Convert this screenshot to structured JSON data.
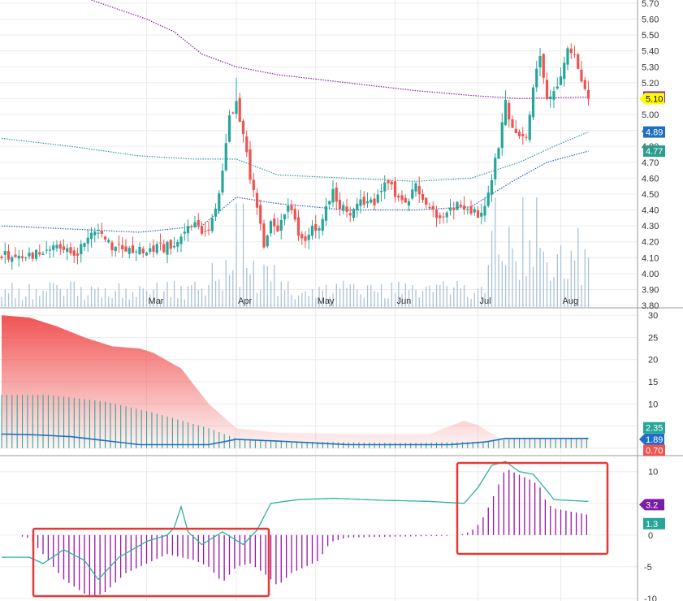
{
  "colors": {
    "up": "#26a69a",
    "down": "#ef5350",
    "volume": "#aac3d6",
    "ma_purple": "#8e1d9e",
    "band_teal": "#2a9d9a",
    "band_blue": "#2f62c7",
    "adx_fill": "#f04a4a",
    "dmi_line": "#1e6fc4",
    "dmi_hist": "#31a89f",
    "macd_hist": "#9a12a8",
    "macd_line": "#2fb0a0",
    "highlight": "#e53935",
    "grid": "#ececec"
  },
  "x_axis": {
    "months": [
      {
        "label": "Mar",
        "day": 42
      },
      {
        "label": "Apr",
        "day": 68
      },
      {
        "label": "May",
        "day": 91
      },
      {
        "label": "Jun",
        "day": 114
      },
      {
        "label": "Jul",
        "day": 138
      },
      {
        "label": "Aug",
        "day": 162
      }
    ]
  },
  "chart_data": [
    {
      "type": "candlestick",
      "name": "price",
      "ylim": [
        3.8,
        5.7
      ],
      "yticks": [
        "5.70",
        "5.60",
        "5.50",
        "5.40",
        "5.30",
        "5.20",
        "5.10",
        "5.00",
        "4.90",
        "4.80",
        "4.70",
        "4.60",
        "4.50",
        "4.40",
        "4.30",
        "4.20",
        "4.10",
        "4.00",
        "3.90",
        "3.80"
      ],
      "anchors": [
        [
          0,
          4.12
        ],
        [
          8,
          4.1
        ],
        [
          14,
          4.18
        ],
        [
          22,
          4.14
        ],
        [
          27,
          4.25
        ],
        [
          32,
          4.18
        ],
        [
          38,
          4.13
        ],
        [
          44,
          4.15
        ],
        [
          50,
          4.18
        ],
        [
          55,
          4.3
        ],
        [
          60,
          4.26
        ],
        [
          62,
          4.42
        ],
        [
          64,
          4.65
        ],
        [
          66,
          5.0
        ],
        [
          68,
          5.06
        ],
        [
          70,
          4.85
        ],
        [
          72,
          4.62
        ],
        [
          74,
          4.42
        ],
        [
          76,
          4.14
        ],
        [
          78,
          4.36
        ],
        [
          80,
          4.3
        ],
        [
          82,
          4.4
        ],
        [
          84,
          4.4
        ],
        [
          86,
          4.25
        ],
        [
          88,
          4.2
        ],
        [
          90,
          4.3
        ],
        [
          92,
          4.28
        ],
        [
          94,
          4.42
        ],
        [
          96,
          4.5
        ],
        [
          98,
          4.4
        ],
        [
          100,
          4.42
        ],
        [
          102,
          4.38
        ],
        [
          104,
          4.45
        ],
        [
          106,
          4.48
        ],
        [
          108,
          4.45
        ],
        [
          110,
          4.5
        ],
        [
          112,
          4.58
        ],
        [
          114,
          4.48
        ],
        [
          116,
          4.45
        ],
        [
          118,
          4.46
        ],
        [
          120,
          4.6
        ],
        [
          122,
          4.46
        ],
        [
          124,
          4.42
        ],
        [
          126,
          4.38
        ],
        [
          128,
          4.36
        ],
        [
          130,
          4.38
        ],
        [
          132,
          4.42
        ],
        [
          134,
          4.4
        ],
        [
          136,
          4.4
        ],
        [
          138,
          4.36
        ],
        [
          140,
          4.45
        ],
        [
          142,
          4.6
        ],
        [
          144,
          4.8
        ],
        [
          146,
          5.08
        ],
        [
          148,
          4.92
        ],
        [
          150,
          4.84
        ],
        [
          152,
          4.88
        ],
        [
          154,
          5.15
        ],
        [
          156,
          5.4
        ],
        [
          158,
          5.08
        ],
        [
          160,
          5.15
        ],
        [
          162,
          5.25
        ],
        [
          164,
          5.4
        ],
        [
          166,
          5.35
        ],
        [
          168,
          5.2
        ],
        [
          170,
          5.1
        ]
      ],
      "y_labels": [
        {
          "text": "5.11",
          "value": 5.11,
          "color": "#8e1d9e"
        },
        {
          "text": "5.10",
          "value": 5.1,
          "color": "#ffff00"
        },
        {
          "text": "4.89",
          "value": 4.89,
          "color": "#1e6fc4"
        },
        {
          "text": "4.77",
          "value": 4.77,
          "color": "#2a9d8f"
        }
      ],
      "overlays": [
        {
          "name": "long-moving-average",
          "anchors": [
            [
              26,
              5.72
            ],
            [
              42,
              5.6
            ],
            [
              50,
              5.52
            ],
            [
              58,
              5.38
            ],
            [
              68,
              5.3
            ],
            [
              80,
              5.25
            ],
            [
              100,
              5.2
            ],
            [
              120,
              5.15
            ],
            [
              136,
              5.12
            ],
            [
              150,
              5.1
            ],
            [
              170,
              5.11
            ]
          ]
        },
        {
          "name": "upper-band",
          "anchors": [
            [
              0,
              4.85
            ],
            [
              20,
              4.8
            ],
            [
              40,
              4.74
            ],
            [
              56,
              4.72
            ],
            [
              68,
              4.72
            ],
            [
              80,
              4.62
            ],
            [
              100,
              4.6
            ],
            [
              120,
              4.58
            ],
            [
              136,
              4.6
            ],
            [
              150,
              4.7
            ],
            [
              160,
              4.8
            ],
            [
              170,
              4.89
            ]
          ]
        },
        {
          "name": "lower-band",
          "anchors": [
            [
              0,
              4.3
            ],
            [
              20,
              4.28
            ],
            [
              40,
              4.26
            ],
            [
              58,
              4.3
            ],
            [
              68,
              4.48
            ],
            [
              80,
              4.44
            ],
            [
              100,
              4.4
            ],
            [
              120,
              4.4
            ],
            [
              136,
              4.42
            ],
            [
              148,
              4.58
            ],
            [
              158,
              4.7
            ],
            [
              170,
              4.77
            ]
          ]
        }
      ]
    },
    {
      "type": "area",
      "name": "adx-panel",
      "ylim": [
        0,
        30
      ],
      "yticks": [
        30,
        25,
        20,
        15,
        10,
        5,
        0
      ],
      "area_anchors": [
        [
          0,
          30
        ],
        [
          8,
          29.5
        ],
        [
          16,
          27.5
        ],
        [
          24,
          25
        ],
        [
          32,
          23
        ],
        [
          40,
          22.5
        ],
        [
          44,
          21.5
        ],
        [
          52,
          18
        ],
        [
          60,
          10
        ],
        [
          68,
          4.5
        ],
        [
          80,
          3.5
        ],
        [
          100,
          3.2
        ],
        [
          124,
          3.2
        ],
        [
          134,
          6.2
        ],
        [
          138,
          5.2
        ],
        [
          144,
          2.3
        ],
        [
          170,
          2.4
        ]
      ],
      "hist_anchors": [
        [
          0,
          12
        ],
        [
          14,
          12
        ],
        [
          30,
          10.5
        ],
        [
          44,
          8
        ],
        [
          60,
          4.5
        ],
        [
          68,
          2.2
        ],
        [
          80,
          1.5
        ],
        [
          120,
          1.2
        ],
        [
          140,
          1.5
        ],
        [
          150,
          2.2
        ],
        [
          170,
          2.2
        ]
      ],
      "line_anchors": [
        [
          0,
          3.2
        ],
        [
          10,
          3.0
        ],
        [
          20,
          2.6
        ],
        [
          40,
          0.8
        ],
        [
          60,
          0.8
        ],
        [
          68,
          2.0
        ],
        [
          80,
          1.6
        ],
        [
          100,
          0.8
        ],
        [
          130,
          0.8
        ],
        [
          140,
          1.4
        ],
        [
          146,
          2.2
        ],
        [
          170,
          2.2
        ]
      ],
      "y_labels": [
        {
          "text": "2.35",
          "value": 4.6,
          "color": "#26a69a"
        },
        {
          "text": "1.89",
          "value": 2.0,
          "color": "#1e6fc4"
        },
        {
          "text": "0.70",
          "value": -0.5,
          "color": "#ef5350"
        }
      ]
    },
    {
      "type": "bar",
      "name": "macd-panel",
      "ylim": [
        -10,
        12
      ],
      "yticks": [
        10,
        5,
        0,
        -5,
        -10
      ],
      "hist_anchors": [
        [
          0,
          0
        ],
        [
          4,
          0
        ],
        [
          8,
          -0.5
        ],
        [
          12,
          -3
        ],
        [
          18,
          -7
        ],
        [
          26,
          -10
        ],
        [
          30,
          -9
        ],
        [
          36,
          -6
        ],
        [
          40,
          -5
        ],
        [
          44,
          -4
        ],
        [
          48,
          -3
        ],
        [
          52,
          -3.5
        ],
        [
          56,
          -4
        ],
        [
          60,
          -5
        ],
        [
          64,
          -7.5
        ],
        [
          68,
          -5
        ],
        [
          72,
          -4.5
        ],
        [
          76,
          -6
        ],
        [
          80,
          -8
        ],
        [
          84,
          -6
        ],
        [
          88,
          -5
        ],
        [
          92,
          -4
        ],
        [
          94,
          -2
        ],
        [
          96,
          -1
        ],
        [
          100,
          -0.4
        ],
        [
          108,
          -0.3
        ],
        [
          120,
          -0.2
        ],
        [
          130,
          -0.1
        ],
        [
          134,
          0.2
        ],
        [
          136,
          0.6
        ],
        [
          138,
          1.6
        ],
        [
          140,
          3.2
        ],
        [
          142,
          5.5
        ],
        [
          144,
          8
        ],
        [
          146,
          10.5
        ],
        [
          148,
          10
        ],
        [
          150,
          9.5
        ],
        [
          152,
          9
        ],
        [
          154,
          8.5
        ],
        [
          156,
          7.5
        ],
        [
          158,
          5
        ],
        [
          160,
          4.2
        ],
        [
          162,
          4
        ],
        [
          170,
          3.2
        ]
      ],
      "line_anchors": [
        [
          0,
          -3.5
        ],
        [
          8,
          -3.5
        ],
        [
          12,
          -4.5
        ],
        [
          18,
          -2.3
        ],
        [
          24,
          -4
        ],
        [
          28,
          -7
        ],
        [
          34,
          -3.5
        ],
        [
          42,
          -1
        ],
        [
          48,
          0
        ],
        [
          50,
          1.2
        ],
        [
          52,
          4.5
        ],
        [
          54,
          0.5
        ],
        [
          58,
          -1.5
        ],
        [
          64,
          0.5
        ],
        [
          70,
          -1.5
        ],
        [
          74,
          0.8
        ],
        [
          78,
          5
        ],
        [
          86,
          5.6
        ],
        [
          96,
          5.8
        ],
        [
          110,
          5.5
        ],
        [
          124,
          5.3
        ],
        [
          134,
          5
        ],
        [
          138,
          7.5
        ],
        [
          142,
          11
        ],
        [
          146,
          11.6
        ],
        [
          150,
          10
        ],
        [
          154,
          9.6
        ],
        [
          158,
          7
        ],
        [
          160,
          5.6
        ],
        [
          170,
          5.3
        ]
      ],
      "y_labels": [
        {
          "text": "3.2",
          "value": 4.8,
          "color": "#7b1fa2"
        },
        {
          "text": "1.3",
          "value": 1.8,
          "color": "#26a69a"
        }
      ]
    }
  ]
}
